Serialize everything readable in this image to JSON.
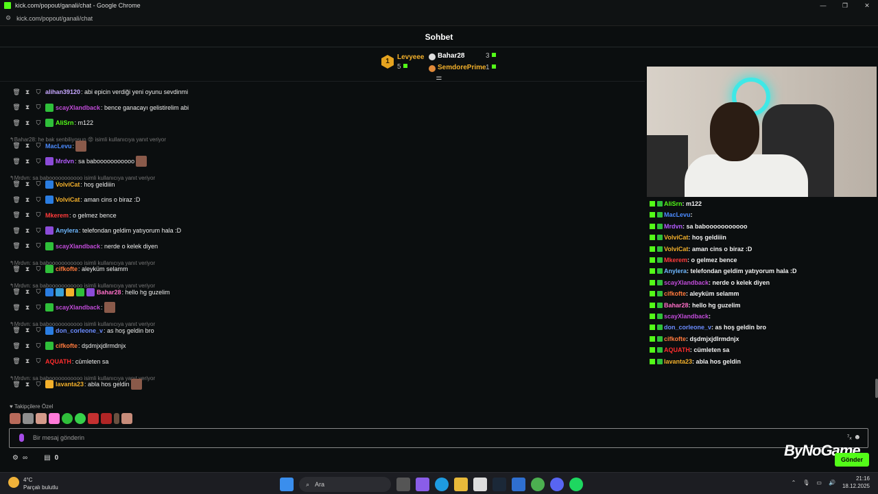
{
  "window": {
    "title": "kick.com/popout/ganali/chat - Google Chrome",
    "url": "kick.com/popout/ganali/chat",
    "min": "—",
    "max": "❐",
    "close": "✕"
  },
  "header": {
    "title": "Sohbet"
  },
  "podium": {
    "first": {
      "rank": "1",
      "name": "Levyeee",
      "count": "5"
    },
    "second": {
      "name": "Bahar28",
      "count": "3"
    },
    "third": {
      "name": "SemdorePrime",
      "count": "1"
    }
  },
  "chat": {
    "messages": [
      {
        "user": "alihan39120",
        "color": "#c6a7ff",
        "msg": ": abi epicin verdiği yeni oyunu sevdinmi",
        "badge": "none"
      },
      {
        "user": "scayXlandback",
        "color": "#c04bd8",
        "msg": ": bence ganacayı gelistirelim abi",
        "badge": "green"
      },
      {
        "user": "AliSrn",
        "color": "#53fc18",
        "msg": ": m122",
        "badge": "green"
      },
      {
        "reply": "Bahar28: he bak senbiliyosun 😡 isimli kullanıcıya yanıt veriyor"
      },
      {
        "user": "MacLevu",
        "color": "#4b8bff",
        "msg": ":",
        "badge": "none",
        "emote": true
      },
      {
        "user": "Mrdvn",
        "color": "#b45cff",
        "msg": ": sa babooooooooooo",
        "badge": "purple",
        "emote": true
      },
      {
        "reply": "Mrdvn: sa babooooooooooo isimli kullanıcıya yanıt veriyor"
      },
      {
        "user": "VolviCat",
        "color": "#f3b02b",
        "msg": ": hoş geldiiin",
        "badge": "blue"
      },
      {
        "user": "VolviCat",
        "color": "#f3b02b",
        "msg": ": aman cins o biraz :D",
        "badge": "blue"
      },
      {
        "user": "Mkerem",
        "color": "#ff3b3b",
        "msg": ": o gelmez bence",
        "badge": "none"
      },
      {
        "user": "Anylera",
        "color": "#6fb8ff",
        "msg": ": telefondan geldim yatıyorum hala :D",
        "badge": "purple"
      },
      {
        "user": "scayXlandback",
        "color": "#c04bd8",
        "msg": ": nerde o kelek diyen",
        "badge": "green"
      },
      {
        "reply": "Mrdvn: sa babooooooooooo isimli kullanıcıya yanıt veriyor"
      },
      {
        "user": "cifkofte",
        "color": "#ff7a3d",
        "msg": ": aleyküm selamm",
        "badge": "green"
      },
      {
        "reply": "Mrdvn: sa babooooooooooo isimli kullanıcıya yanıt veriyor"
      },
      {
        "user": "Bahar28",
        "color": "#ff6ec7",
        "msg": ": hello hg guzelim",
        "badge": "multi"
      },
      {
        "user": "scayXlandback",
        "color": "#c04bd8",
        "msg": ":",
        "badge": "green",
        "emote": true
      },
      {
        "reply": "Mrdvn: sa babooooooooooo isimli kullanıcıya yanıt veriyor"
      },
      {
        "user": "don_corleone_v",
        "color": "#6b8cff",
        "msg": ": as hoş geldin bro",
        "badge": "blue"
      },
      {
        "user": "cifkofte",
        "color": "#ff7a3d",
        "msg": ": dşdmjxjdlrmdnjx",
        "badge": "green"
      },
      {
        "user": "AQUATH",
        "color": "#ff2d2d",
        "msg": ": cümleten sa",
        "badge": "none"
      },
      {
        "reply": "Mrdvn: sa babooooooooooo isimli kullanıcıya yanıt veriyor"
      },
      {
        "user": "lavanta23",
        "color": "#f3b02b",
        "msg": ": abla hos geldin",
        "badge": "crown",
        "emote": true
      }
    ]
  },
  "followers_label": "Takipçilere Özel",
  "input": {
    "placeholder": "Bir mesaj gönderin"
  },
  "bottom": {
    "infinite": "∞",
    "points": "0"
  },
  "send_label": "Gönder",
  "watermark": "ByNoGame",
  "overlay": {
    "messages": [
      {
        "user": "AliSrn",
        "color": "#53fc18",
        "msg": ": m122"
      },
      {
        "user": "MacLevu",
        "color": "#4b8bff",
        "msg": ":"
      },
      {
        "user": "Mrdvn",
        "color": "#b45cff",
        "msg": ": sa babooooooooooo"
      },
      {
        "user": "VolviCat",
        "color": "#f3b02b",
        "msg": ": hoş geldiiin"
      },
      {
        "user": "VolviCat",
        "color": "#f3b02b",
        "msg": ": aman cins o biraz :D"
      },
      {
        "user": "Mkerem",
        "color": "#ff3b3b",
        "msg": ": o gelmez bence"
      },
      {
        "user": "Anylera",
        "color": "#6fb8ff",
        "msg": ": telefondan geldim yatıyorum hala :D"
      },
      {
        "user": "scayXlandback",
        "color": "#c04bd8",
        "msg": ": nerde o kelek diyen"
      },
      {
        "user": "cifkofte",
        "color": "#ff7a3d",
        "msg": ": aleyküm selamm"
      },
      {
        "user": "Bahar28",
        "color": "#ff6ec7",
        "msg": ": hello hg guzelim"
      },
      {
        "user": "scayXlandback",
        "color": "#c04bd8",
        "msg": ":"
      },
      {
        "user": "don_corleone_v",
        "color": "#6b8cff",
        "msg": ": as hoş geldin bro"
      },
      {
        "user": "cifkofte",
        "color": "#ff7a3d",
        "msg": ": dşdmjxjdlrmdnjx"
      },
      {
        "user": "AQUATH",
        "color": "#ff2d2d",
        "msg": ": cümleten sa"
      },
      {
        "user": "lavanta23",
        "color": "#f3b02b",
        "msg": ": abla hos geldin"
      }
    ]
  },
  "taskbar": {
    "weather_temp": "4°C",
    "weather_desc": "Parçalı bulutlu",
    "search": "Ara",
    "time": "21:16",
    "date": "18.12.2025"
  }
}
